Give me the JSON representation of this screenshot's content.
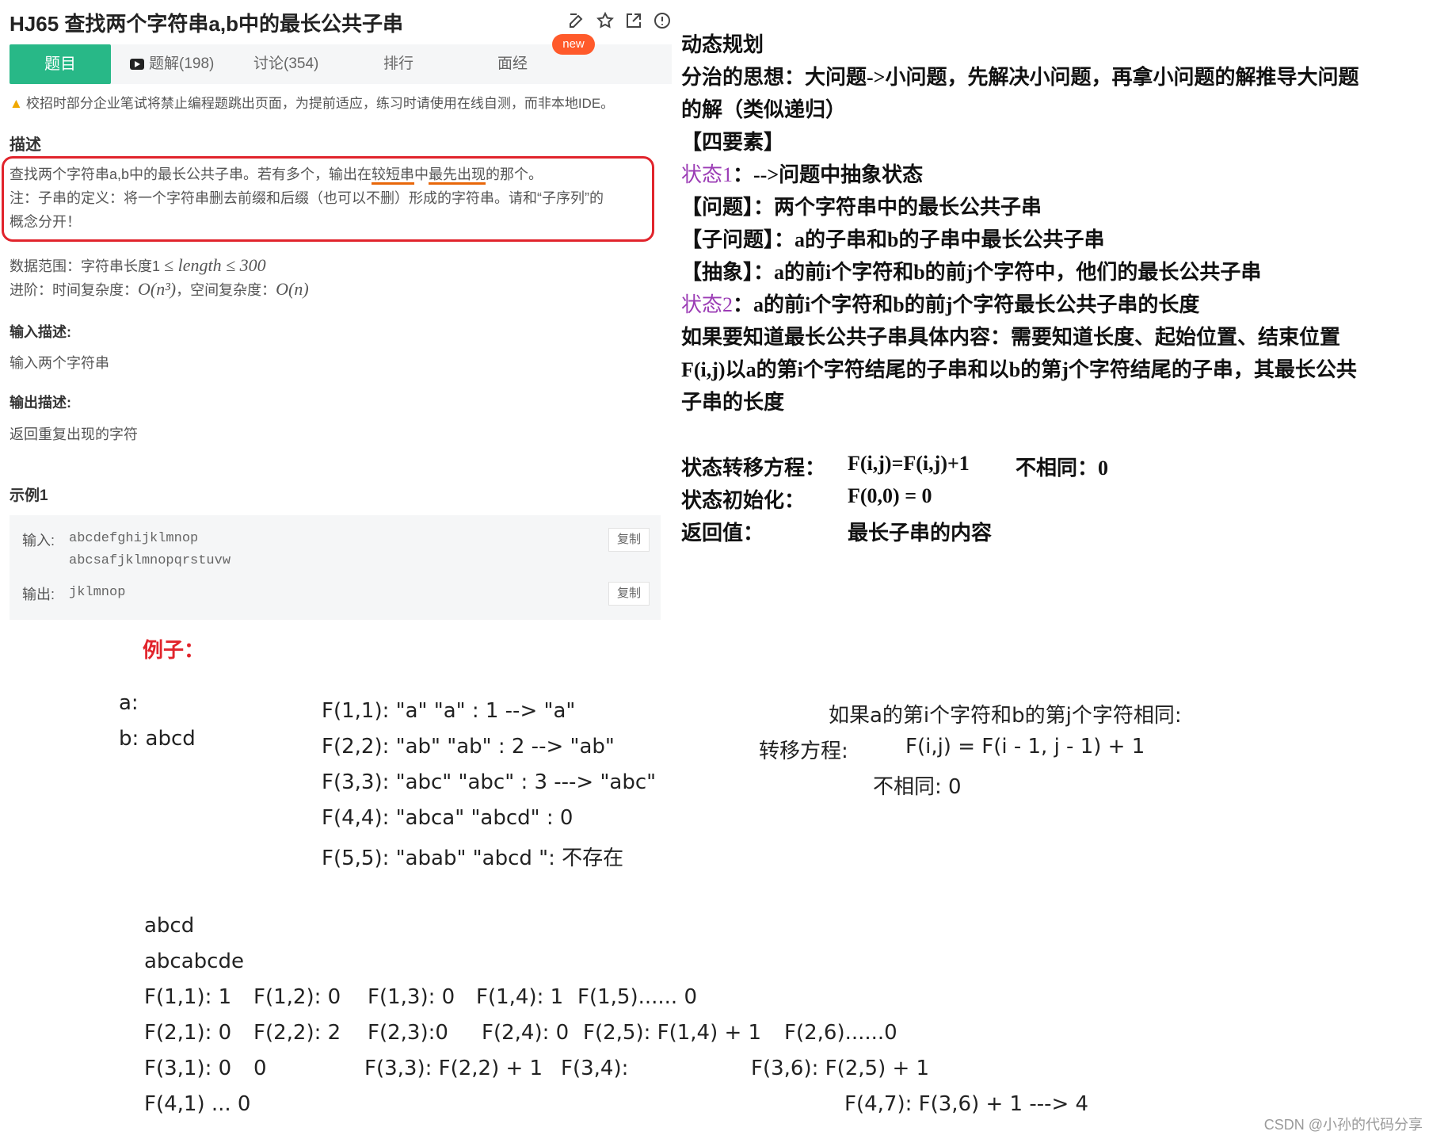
{
  "header": {
    "title": "HJ65  查找两个字符串a,b中的最长公共子串",
    "icons": [
      "edit-icon",
      "star-icon",
      "share-icon",
      "info-icon"
    ]
  },
  "tabs": {
    "active": "题目",
    "solutions": "题解(198)",
    "discussion": "讨论(354)",
    "ranking": "排行",
    "interview": "面经",
    "new_badge": "new"
  },
  "notice": "校招时部分企业笔试将禁止编程题跳出页面，为提前适应，练习时请使用在线自测，而非本地IDE。",
  "description": {
    "heading": "描述",
    "line1_a": "查找两个字符串a,b中的最长公共子串。若有多个，输出在",
    "line1_ul1": "较短串",
    "line1_b": "中",
    "line1_ul2": "最先出现",
    "line1_c": "的那个。",
    "line2": "注：子串的定义：将一个字符串删去前缀和后缀（也可以不删）形成的字符串。请和“子序列”的",
    "line3": "概念分开！",
    "range_label": "数据范围：字符串长度1",
    "range_math": "≤ length ≤ 300",
    "adv_label": "进阶：时间复杂度：",
    "adv_time": "O(n³)",
    "adv_space_label": "，空间复杂度：",
    "adv_space": "O(n)"
  },
  "input": {
    "heading": "输入描述:",
    "text": "输入两个字符串"
  },
  "output": {
    "heading": "输出描述:",
    "text": "返回重复出现的字符"
  },
  "example": {
    "heading": "示例1",
    "input_label": "输入:",
    "input_line1": "abcdefghijklmnop",
    "input_line2": "abcsafjklmnopqrstuvw",
    "output_label": "输出:",
    "output_value": "jklmnop",
    "copy_label": "复制"
  },
  "notes": {
    "l1": "动态规划",
    "l2": "分治的思想：大问题->小问题，先解决小问题，再拿小问题的解推导大问题",
    "l3": "的解（类似递归）",
    "l4": "【四要素】",
    "l5_tag": "状态1",
    "l5_rest": "：-->问题中抽象状态",
    "l6": "【问题】：两个字符串中的最长公共子串",
    "l7": "【子问题】：a的子串和b的子串中最长公共子串",
    "l8": "【抽象】：a的前i个字符和b的前j个字符中，他们的最长公共子串",
    "l9_tag": "状态2",
    "l9_rest": "：a的前i个字符和b的前j个字符最长公共子串的长度",
    "l10": "如果要知道最长公共子串具体内容：需要知道长度、起始位置、结束位置",
    "l11": "F(i,j)以a的第i个字符结尾的子串和以b的第j个字符结尾的子串，其最长公共",
    "l12": "子串的长度",
    "eq_label": "状态转移方程：",
    "eq_value": "F(i,j)=F(i,j)+1",
    "eq_diff": "不相同：0",
    "init_label": "状态初始化：",
    "init_value": "F(0,0) = 0",
    "ret_label": "返回值：",
    "ret_value": "最长子串的内容"
  },
  "slide": {
    "example_label": "例子：",
    "a_label": "a:",
    "b_label": "b:  abcd",
    "rows1": [
      "F(1,1):  \"a\"   \"a\"   : 1  --> \"a\"",
      "F(2,2):  \"ab\"   \"ab\" : 2 --> \"ab\"",
      "F(3,3):  \"abc\"   \"abc\" : 3  ---> \"abc\"",
      "F(4,4):  \"abca\"  \"abcd\" :  0",
      "F(5,5): \"abab\"   \"abcd \": 不存在"
    ],
    "same_title": "如果a的第i个字符和b的第j个字符相同:",
    "trans_label": "转移方程:",
    "trans_value": "F(i,j) = F(i - 1, j - 1) + 1",
    "diff": "不相同:  0",
    "s1": "abcd",
    "s2": "abcabcde",
    "grid": [
      [
        "F(1,1): 1",
        "F(1,2): 0",
        "F(1,3): 0",
        "F(1,4): 1",
        "F(1,5)...... 0"
      ],
      [
        "F(2,1): 0",
        "F(2,2): 2",
        "F(2,3):0",
        "F(2,4): 0",
        "F(2,5):  F(1,4)   + 1",
        "F(2,6)......0"
      ],
      [
        "F(3,1): 0",
        "0",
        "F(3,3): F(2,2)  + 1",
        "F(3,4):",
        "F(3,6): F(2,5)  + 1"
      ],
      [
        "F(4,1) ... 0",
        "F(4,7): F(3,6)  + 1   ---> 4"
      ]
    ]
  },
  "watermark": "CSDN @小孙的代码分享"
}
